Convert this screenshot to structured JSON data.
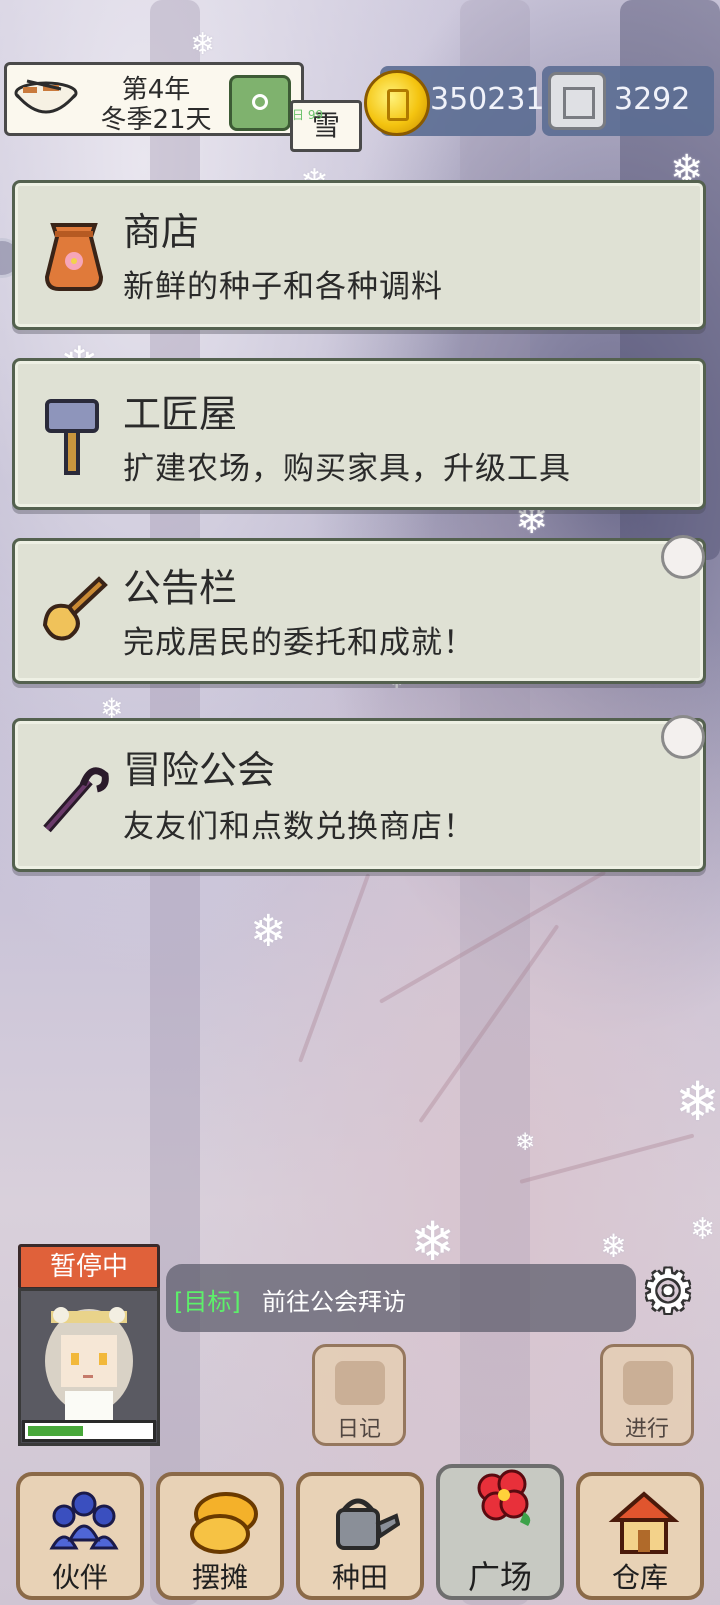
{
  "status_bar": {
    "year": "第4年",
    "season_day": "冬季21天",
    "weather": "雪",
    "weather_small": "日 99",
    "coins": "350231",
    "gems": "3292"
  },
  "menu": [
    {
      "title": "商店",
      "desc": "新鲜的种子和各种调料",
      "icon": "seed-bag-icon"
    },
    {
      "title": "工匠屋",
      "desc": "扩建农场，购买家具，升级工具",
      "icon": "hammer-icon"
    },
    {
      "title": "公告栏",
      "desc": "完成居民的委托和成就！",
      "icon": "horn-icon"
    },
    {
      "title": "冒险公会",
      "desc": "友友们和点数兑换商店！",
      "icon": "staff-icon"
    }
  ],
  "character": {
    "status": "暂停中",
    "hp_fraction": 0.45
  },
  "goal": {
    "tag": "[目标]",
    "text": "前往公会拜访"
  },
  "quick_buttons": {
    "diary": "日记",
    "proceed": "进行"
  },
  "bottom_nav": [
    {
      "label": "伙伴",
      "icon": "people-icon"
    },
    {
      "label": "摆摊",
      "icon": "stall-icon"
    },
    {
      "label": "种田",
      "icon": "watering-can-icon"
    },
    {
      "label": "广场",
      "icon": "flower-icon"
    },
    {
      "label": "仓库",
      "icon": "house-icon"
    }
  ],
  "colors": {
    "card_bg": "#dfe1d4",
    "paused_bg": "#e0613a",
    "goal_tag": "#5df06a"
  }
}
